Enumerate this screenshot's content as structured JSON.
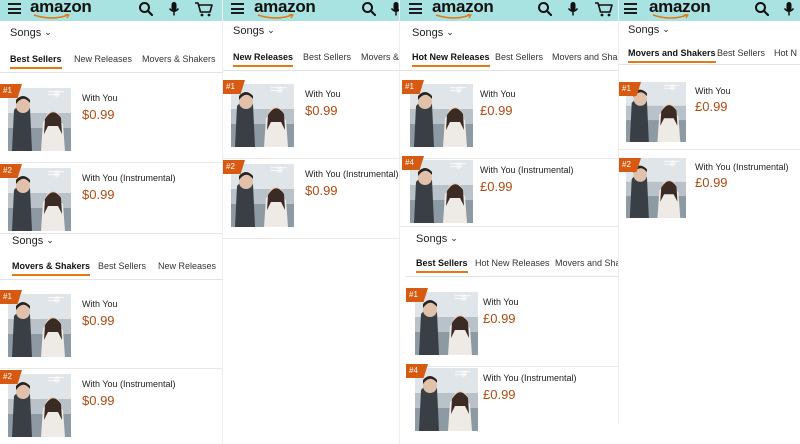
{
  "brand": {
    "logo_text": "amazon"
  },
  "panels": [
    {
      "id": "p1",
      "songs_label": "Songs",
      "tabs": [
        "Best Sellers",
        "New Releases",
        "Movers & Shakers"
      ],
      "items": [
        {
          "rank": "#1",
          "title": "With You",
          "price": "$0.99"
        },
        {
          "rank": "#2",
          "title": "With You (Instrumental)",
          "price": "$0.99"
        }
      ]
    },
    {
      "id": "p2",
      "songs_label": "Songs",
      "tabs": [
        "New Releases",
        "Best Sellers",
        "Movers &"
      ],
      "items": [
        {
          "rank": "#1",
          "title": "With You",
          "price": "$0.99"
        },
        {
          "rank": "#2",
          "title": "With You (Instrumental)",
          "price": "$0.99"
        }
      ]
    },
    {
      "id": "p3",
      "songs_label": "Songs",
      "tabs": [
        "Hot New Releases",
        "Best Sellers",
        "Movers and Shake"
      ],
      "items": [
        {
          "rank": "#1",
          "title": "With You",
          "price": "£0.99"
        },
        {
          "rank": "#4",
          "title": "With You (Instrumental)",
          "price": "£0.99"
        }
      ]
    },
    {
      "id": "p4",
      "songs_label": "Songs",
      "tabs": [
        "Movers and Shakers",
        "Best Sellers",
        "Hot N"
      ],
      "items": [
        {
          "rank": "#1",
          "title": "With You",
          "price": "£0.99"
        },
        {
          "rank": "#2",
          "title": "With You (Instrumental)",
          "price": "£0.99"
        }
      ]
    },
    {
      "id": "p5",
      "songs_label": "Songs",
      "tabs": [
        "Movers & Shakers",
        "Best Sellers",
        "New Releases"
      ],
      "items": [
        {
          "rank": "#1",
          "title": "With You",
          "price": "$0.99"
        },
        {
          "rank": "#2",
          "title": "With You (Instrumental)",
          "price": "$0.99"
        }
      ]
    },
    {
      "id": "p6",
      "songs_label": "Songs",
      "tabs": [
        "Best Sellers",
        "Hot New Releases",
        "Movers and Shake"
      ],
      "items": [
        {
          "rank": "#1",
          "title": "With You",
          "price": "£0.99"
        },
        {
          "rank": "#4",
          "title": "With You (Instrumental)",
          "price": "£0.99"
        }
      ]
    }
  ],
  "colors": {
    "header": "#a8e3e1",
    "accent": "#e47911",
    "price": "#b04a12",
    "badge": "#d65a12"
  }
}
